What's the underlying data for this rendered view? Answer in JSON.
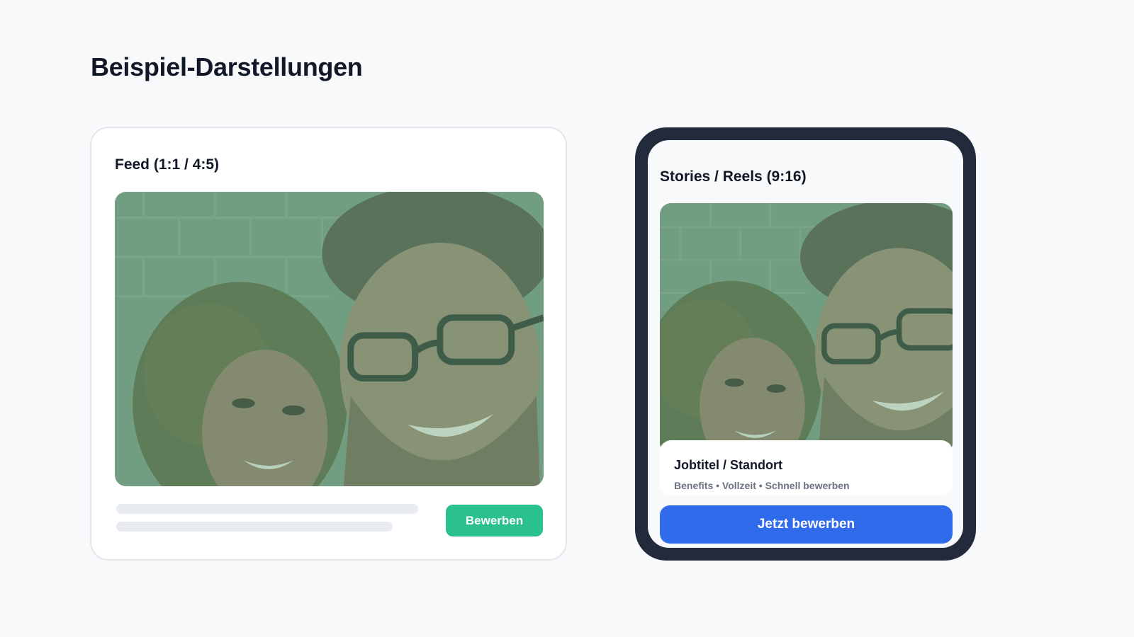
{
  "page": {
    "title": "Beispiel-Darstellungen"
  },
  "feed": {
    "title": "Feed (1:1 / 4:5)",
    "apply_label": "Bewerben",
    "image_description": "two smiling people photo with green overlay"
  },
  "story": {
    "title": "Stories / Reels (9:16)",
    "job_title": "Jobtitel / Standort",
    "job_subtitle": "Benefits • Vollzeit • Schnell bewerben",
    "apply_label": "Jetzt bewerben"
  },
  "colors": {
    "background": "#f7f9fb",
    "feed_button": "#2bc08f",
    "story_button": "#2f6bea",
    "phone_frame": "#232a3c",
    "image_overlay": "#5f9e78"
  }
}
